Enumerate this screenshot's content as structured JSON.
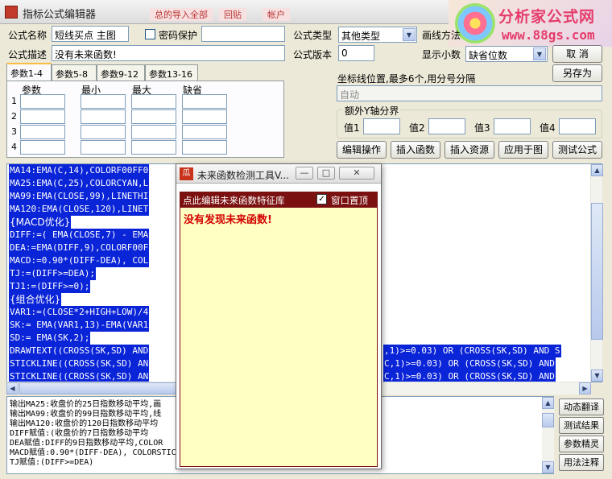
{
  "window": {
    "title": "指标公式编辑器"
  },
  "background_menu": [
    "总的导入全部",
    "回贴",
    "帐户"
  ],
  "logo": {
    "brand": "分析家公式网",
    "url": "www.88gs.com"
  },
  "form": {
    "name_label": "公式名称",
    "name_value": "短线买点 主图",
    "password_label": "密码保护",
    "password_value": "",
    "type_label": "公式类型",
    "type_value": "其他类型",
    "draw_label": "画线方法",
    "draw_value": "主图叠加",
    "ok_label": "确 定",
    "desc_label": "公式描述",
    "desc_value": "没有未来函数!",
    "version_label": "公式版本",
    "version_value": "0",
    "decimal_label": "显示小数",
    "decimal_value": "缺省位数",
    "cancel_label": "取 消",
    "saveas_label": "另存为"
  },
  "param_tabs": [
    "参数1-4",
    "参数5-8",
    "参数9-12",
    "参数13-16"
  ],
  "param_headers": [
    "参数",
    "最小",
    "最大",
    "缺省"
  ],
  "param_rows": [
    "1",
    "2",
    "3",
    "4"
  ],
  "axis": {
    "label": "坐标线位置,最多6个,用分号分隔",
    "value": "自动",
    "group_label": "额外Y轴分界",
    "fields": [
      "值1",
      "值2",
      "值3",
      "值4"
    ]
  },
  "actions": [
    "编辑操作",
    "插入函数",
    "插入资源",
    "应用于图",
    "测试公式"
  ],
  "code_lines": [
    "MA14:EMA(C,14),COLORF00FF0",
    "MA25:EMA(C,25),COLORCYAN,L",
    "MA99:EMA(CLOSE,99),LINETHI",
    "MA120:EMA(CLOSE,120),LINET",
    "{MACD优化}",
    "DIFF:=( EMA(CLOSE,7) - EMA",
    "DEA:=EMA(DIFF,9),COLORF00F",
    "MACD:=0.90*(DIFF-DEA), COL",
    "TJ:=(DIFF>=DEA);",
    "TJ1:=(DIFF>=0);",
    "{组合优化}",
    "VAR1:=(CLOSE*2+HIGH+LOW)/4",
    "SK:= EMA(VAR1,13)-EMA(VAR1",
    "SD:= EMA(SK,2);",
    "DRAWTEXT((CROSS(SK,SD) AND",
    "STICKLINE((CROSS(SK,SD) AN",
    "STICKLINE((CROSS(SK,SD) AN"
  ],
  "code_tails": [
    ",1)>=0.03) OR (CROSS(SK,SD) AND S",
    "C,1)>=0.03) OR (CROSS(SK,SD) AND",
    "C,1)>=0.03) OR (CROSS(SK,SD) AND"
  ],
  "output_lines": [
    "输出MA25:收盘价的25日指数移动平均,画",
    "输出MA99:收盘价的99日指数移动平均,线",
    "输出MA120:收盘价的120日指数移动平均",
    "DIFF赋值:(收盘价的7日指数移动平均",
    "DEA赋值:DIFF的9日指数移动平均,COLOR",
    "MACD赋值:0.90*(DIFF-DEA), COLORSTIC",
    "TJ赋值:(DIFF>=DEA)"
  ],
  "side_buttons": [
    "动态翻译",
    "测试结果",
    "参数精灵",
    "用法注释"
  ],
  "popup": {
    "icon": "瓜",
    "title": "未来函数检测工具V...",
    "header": "点此编辑未来函数特征库",
    "pin_label": "窗口置顶",
    "pin_checked": "✓",
    "result": "没有发现未来函数!"
  }
}
